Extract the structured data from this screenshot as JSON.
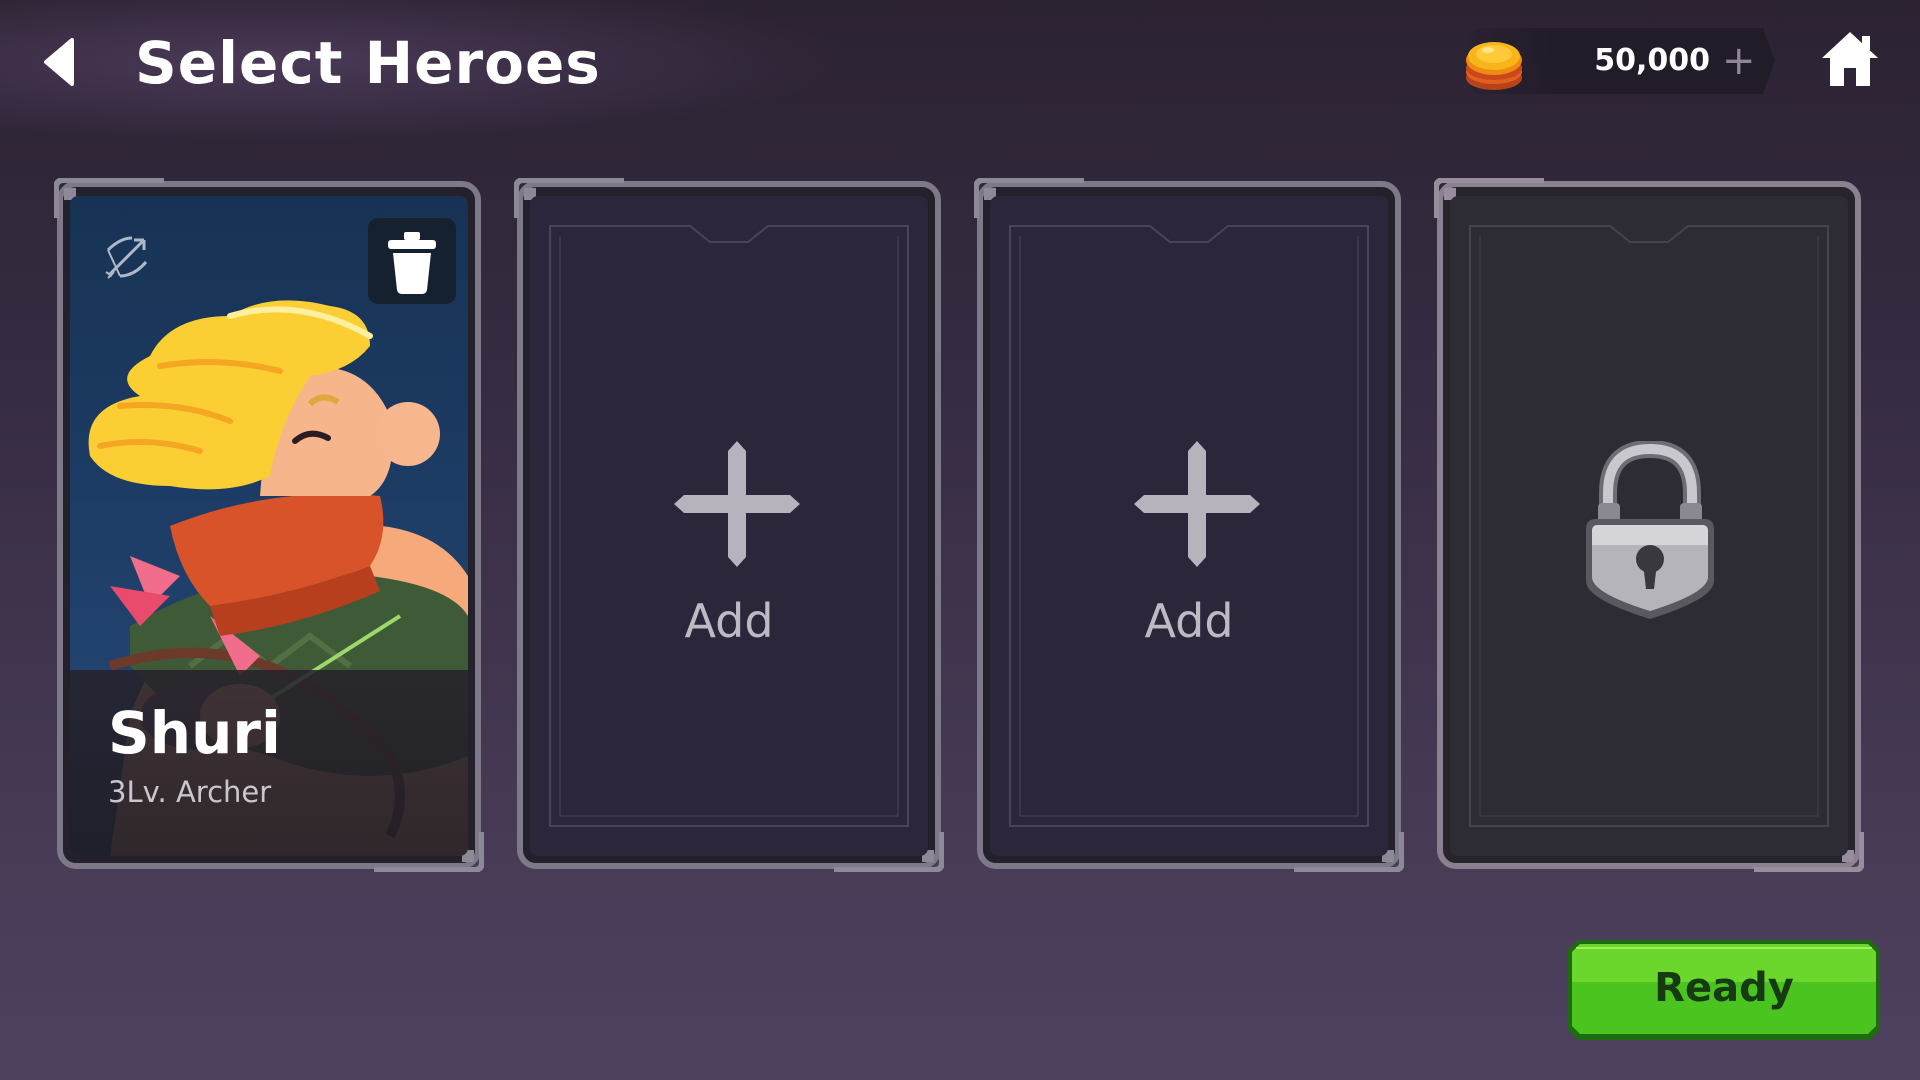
{
  "header": {
    "title": "Select Heroes",
    "back_icon": "back-arrow-icon",
    "home_icon": "home-icon"
  },
  "currency": {
    "amount": "50,000",
    "add_label": "+",
    "icon": "gold-coin-icon"
  },
  "slots": [
    {
      "state": "filled",
      "hero_name": "Shuri",
      "hero_level": "3Lv. Archer",
      "class_icon": "bow-class-icon",
      "delete_icon": "trash-icon"
    },
    {
      "state": "empty",
      "add_label": "Add",
      "icon": "plus-icon"
    },
    {
      "state": "empty",
      "add_label": "Add",
      "icon": "plus-icon"
    },
    {
      "state": "locked",
      "icon": "padlock-icon"
    }
  ],
  "ready_button": {
    "label": "Ready"
  },
  "colors": {
    "background_top": "#2b2232",
    "background_bottom": "#4e4160",
    "ready_green": "#4cc41f",
    "hero_card_blue": "#1d3c65",
    "empty_slot": "#2b2639"
  }
}
